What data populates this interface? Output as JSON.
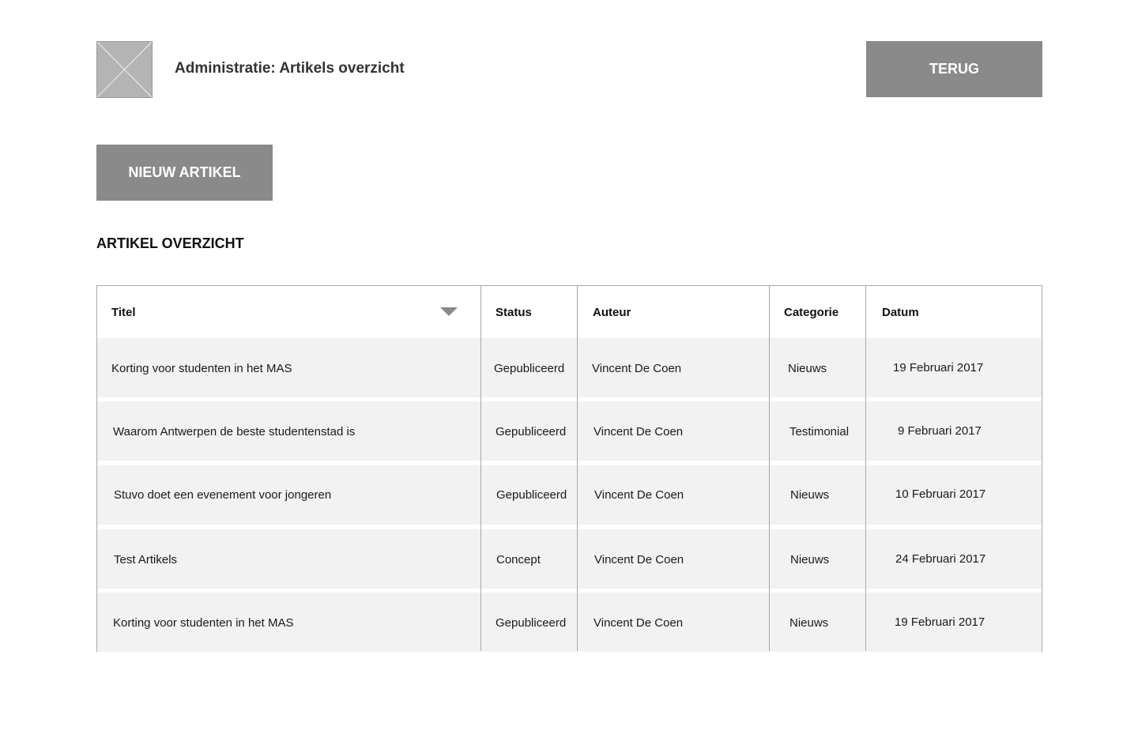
{
  "header": {
    "title": "Administratie: Artikels overzicht",
    "back_label": "TERUG",
    "logo_icon": "image-placeholder-icon"
  },
  "toolbar": {
    "new_label": "NIEUW ARTIKEL"
  },
  "section": {
    "title": "ARTIKEL OVERZICHT"
  },
  "table": {
    "columns": [
      "Titel",
      "Status",
      "Auteur",
      "Categorie",
      "Datum"
    ],
    "sort_icon": "triangle-down-icon",
    "rows": [
      {
        "titel": "Korting voor studenten in het MAS",
        "status": "Gepubliceerd",
        "auteur": "Vincent De Coen",
        "categorie": "Nieuws",
        "datum": "19 Februari 2017"
      },
      {
        "titel": "Waarom Antwerpen de beste studentenstad is",
        "status": "Gepubliceerd",
        "auteur": "Vincent De Coen",
        "categorie": "Testimonial",
        "datum": "9 Februari 2017"
      },
      {
        "titel": "Stuvo doet een evenement voor jongeren",
        "status": "Gepubliceerd",
        "auteur": "Vincent De Coen",
        "categorie": "Nieuws",
        "datum": "10 Februari 2017"
      },
      {
        "titel": "Test Artikels",
        "status": "Concept",
        "auteur": "Vincent De Coen",
        "categorie": "Nieuws",
        "datum": "24 Februari 2017"
      },
      {
        "titel": "Korting voor studenten in het MAS",
        "status": "Gepubliceerd",
        "auteur": "Vincent De Coen",
        "categorie": "Nieuws",
        "datum": "19 Februari 2017"
      }
    ]
  },
  "colors": {
    "button_bg": "#8a8a8a",
    "row_bg": "#f2f2f2",
    "border": "#a8a8a8"
  }
}
